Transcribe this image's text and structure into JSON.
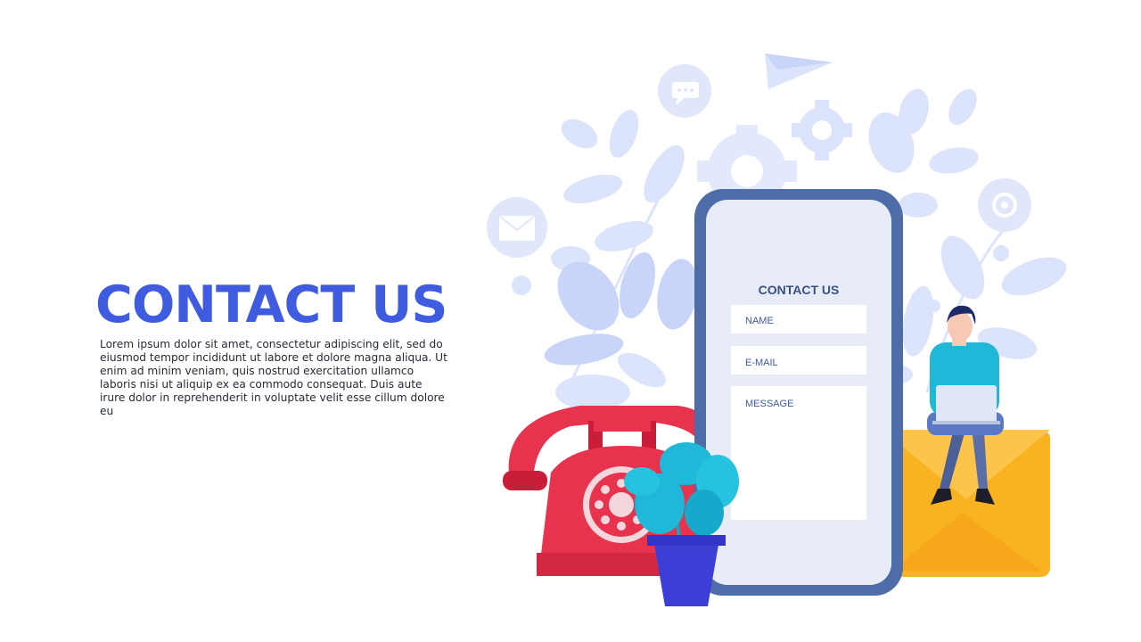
{
  "hero": {
    "title": "CONTACT US",
    "description": "Lorem ipsum dolor sit amet, consectetur adipiscing elit, sed do eiusmod tempor incididunt ut labore et dolore magna aliqua. Ut enim ad minim veniam, quis nostrud exercitation ullamco laboris nisi ut aliquip ex ea commodo consequat. Duis aute irure dolor in reprehenderit in voluptate velit esse cillum dolore eu"
  },
  "form": {
    "title": "CONTACT US",
    "name_placeholder": "NAME",
    "email_placeholder": "E-MAIL",
    "message_placeholder": "MESSAGE"
  },
  "colors": {
    "accent": "#3f5be0",
    "phone_frame": "#4e6da8",
    "telephone": "#e8334f",
    "envelope": "#f9b320",
    "pot": "#3b3fd6",
    "plant": "#1fb8d8",
    "background_shapes": "#d9e3fb"
  },
  "icons": [
    "paper-plane-icon",
    "chat-bubble-icon",
    "gear-icon",
    "mail-icon",
    "at-sign-icon",
    "telephone-icon",
    "envelope-icon",
    "potted-plant-icon",
    "laptop-icon"
  ]
}
